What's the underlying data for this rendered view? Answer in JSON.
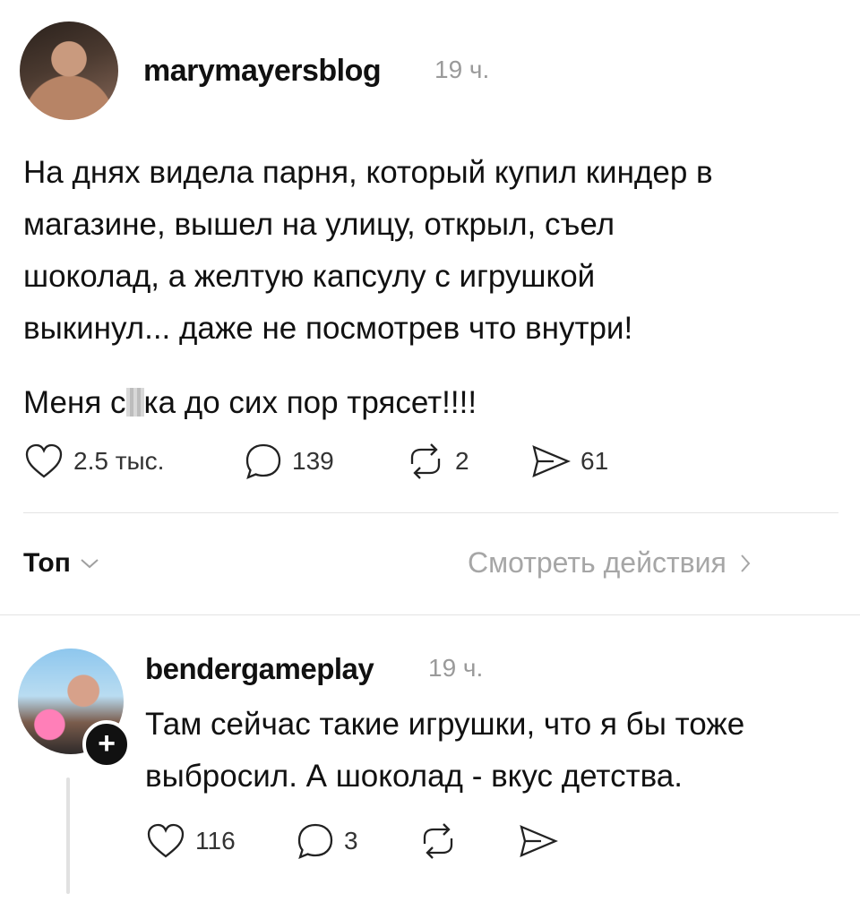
{
  "post": {
    "username": "marymayersblog",
    "time": "19 ч.",
    "lines": [
      "На днях видела парня, который купил киндер в",
      "магазине, вышел на улицу, открыл, съел",
      "шоколад, а желтую капсулу с игрушкой",
      "выкинул... даже не посмотрев что внутри!"
    ],
    "line2_start": "Меня с",
    "line2_end": "ка до сих пор трясет!!!!",
    "actions": {
      "likes": "2.5 тыс.",
      "comments": "139",
      "reposts": "2",
      "shares": "61"
    }
  },
  "sort": {
    "label": "Топ",
    "view_activity": "Смотреть действия"
  },
  "reply": {
    "username": "bendergameplay",
    "time": "19 ч.",
    "lines": [
      "Там сейчас такие игрушки, что я бы тоже",
      "выбросил. А шоколад - вкус детства."
    ],
    "follow_symbol": "+",
    "actions": {
      "likes": "116",
      "comments": "3"
    }
  },
  "icons": [
    "heart-icon",
    "comment-icon",
    "repost-icon",
    "share-icon",
    "chevron-down-icon",
    "chevron-right-icon",
    "plus-icon"
  ]
}
